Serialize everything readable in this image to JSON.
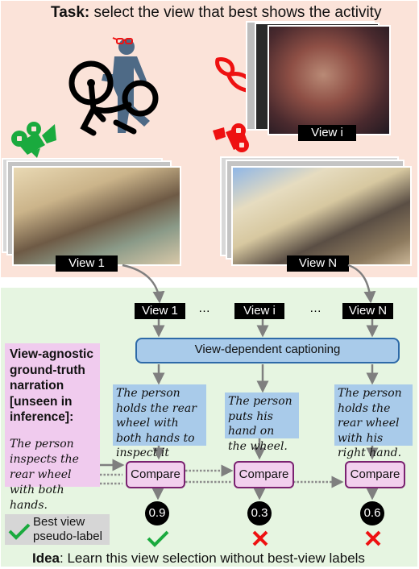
{
  "top_panel": {
    "task_label": "Task:",
    "task_text": " select the view that best shows the activity",
    "view_i_label": "View i",
    "view_1_label": "View 1",
    "view_n_label": "View N",
    "icons": {
      "actor": "person-with-bike-icon",
      "ego_glasses": "glasses-icon",
      "best_camera": "movie-camera-icon",
      "other_camera": "movie-camera-icon"
    },
    "colors": {
      "background": "#fbe3d9",
      "best": "#1aaa3e",
      "not_best": "#ee1111",
      "person": "#4e6a86"
    }
  },
  "bottom_panel": {
    "views": [
      {
        "label": "View 1"
      },
      {
        "label": "View i"
      },
      {
        "label": "View N"
      }
    ],
    "ellipsis": "…",
    "captioning_label": "View-dependent captioning",
    "ground_truth": {
      "heading": "View-agnostic ground-truth narration [unseen in inference]:",
      "narration": "The person inspects the rear wheel with both hands."
    },
    "captions": [
      "The person holds the rear wheel with both hands to inspect it",
      "The person puts his hand on the wheel.",
      "The person holds the rear wheel with his right hand."
    ],
    "compare_label": "Compare",
    "scores": [
      "0.9",
      "0.3",
      "0.6"
    ],
    "marks": [
      "check",
      "cross",
      "cross"
    ],
    "legend": {
      "label": "Best view pseudo-label",
      "icon": "check-icon"
    },
    "idea_label": "Idea",
    "idea_text": ": Learn this view selection without best-view labels",
    "colors": {
      "background": "#e6f5e1",
      "caption": "#a9cbea",
      "compare": "#f2d0ee",
      "compare_border": "#7a2270",
      "ground_truth": "#f0cbee"
    }
  }
}
